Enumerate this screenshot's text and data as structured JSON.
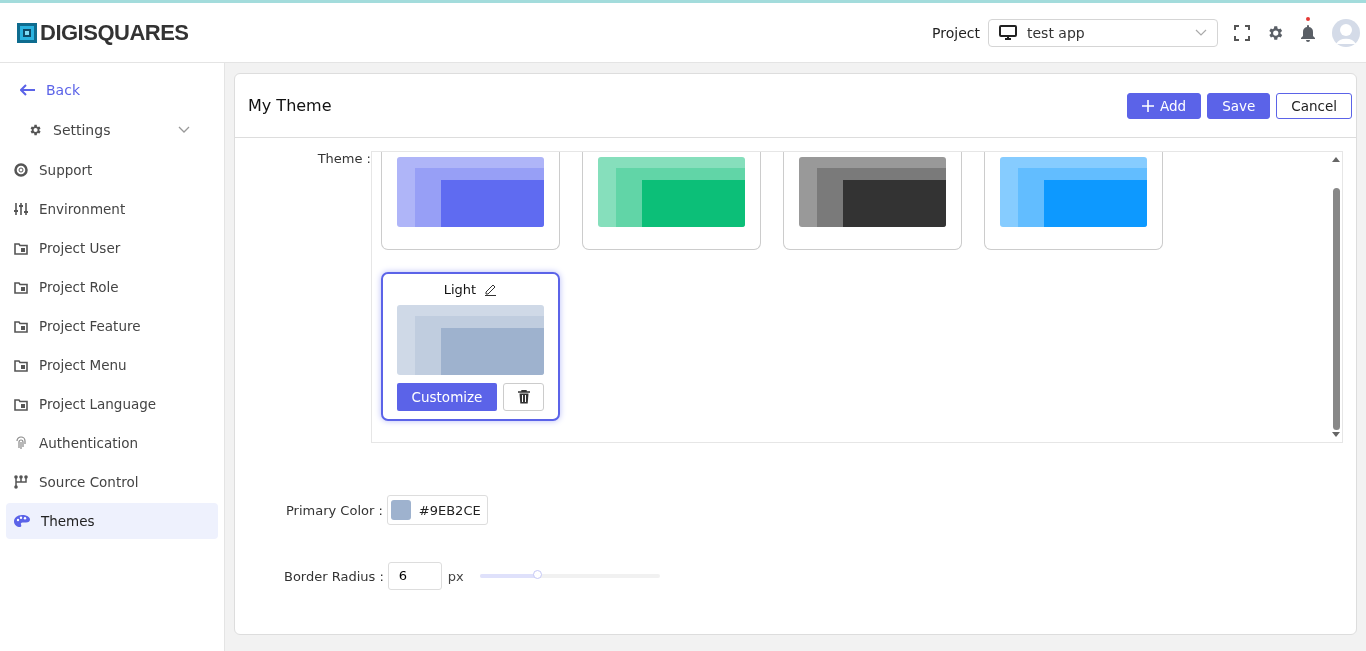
{
  "header": {
    "logo": "DIGISQUARES",
    "project_label": "Project",
    "project_select": {
      "value": "test app"
    },
    "notification_dot": true
  },
  "sidebar": {
    "back": "Back",
    "group": {
      "label": "Settings",
      "expanded": true
    },
    "items": [
      {
        "label": "Support",
        "selected": false
      },
      {
        "label": "Environment",
        "selected": false
      },
      {
        "label": "Project User",
        "selected": false
      },
      {
        "label": "Project Role",
        "selected": false
      },
      {
        "label": "Project Feature",
        "selected": false
      },
      {
        "label": "Project Menu",
        "selected": false
      },
      {
        "label": "Project Language",
        "selected": false
      },
      {
        "label": "Authentication",
        "selected": false
      },
      {
        "label": "Source Control",
        "selected": false
      },
      {
        "label": "Themes",
        "selected": true
      }
    ]
  },
  "panel": {
    "title": "My Theme",
    "buttons": {
      "add": "Add",
      "save": "Save",
      "cancel": "Cancel"
    },
    "theme_label": "Theme :",
    "themes": [
      {
        "color": "#5f6bf1",
        "selected": false
      },
      {
        "color": "#0cbf78",
        "selected": false
      },
      {
        "color": "#333333",
        "selected": false
      },
      {
        "color": "#0d99ff",
        "selected": false
      },
      {
        "name": "Light",
        "color": "#9eb2ce",
        "selected": true,
        "customize": "Customize"
      }
    ],
    "primary_color": {
      "label": "Primary Color :",
      "color": "#9eb2ce",
      "value": "#9EB2CE"
    },
    "border_radius": {
      "label": "Border Radius :",
      "value": "6",
      "unit": "px",
      "level": 0.33
    }
  }
}
